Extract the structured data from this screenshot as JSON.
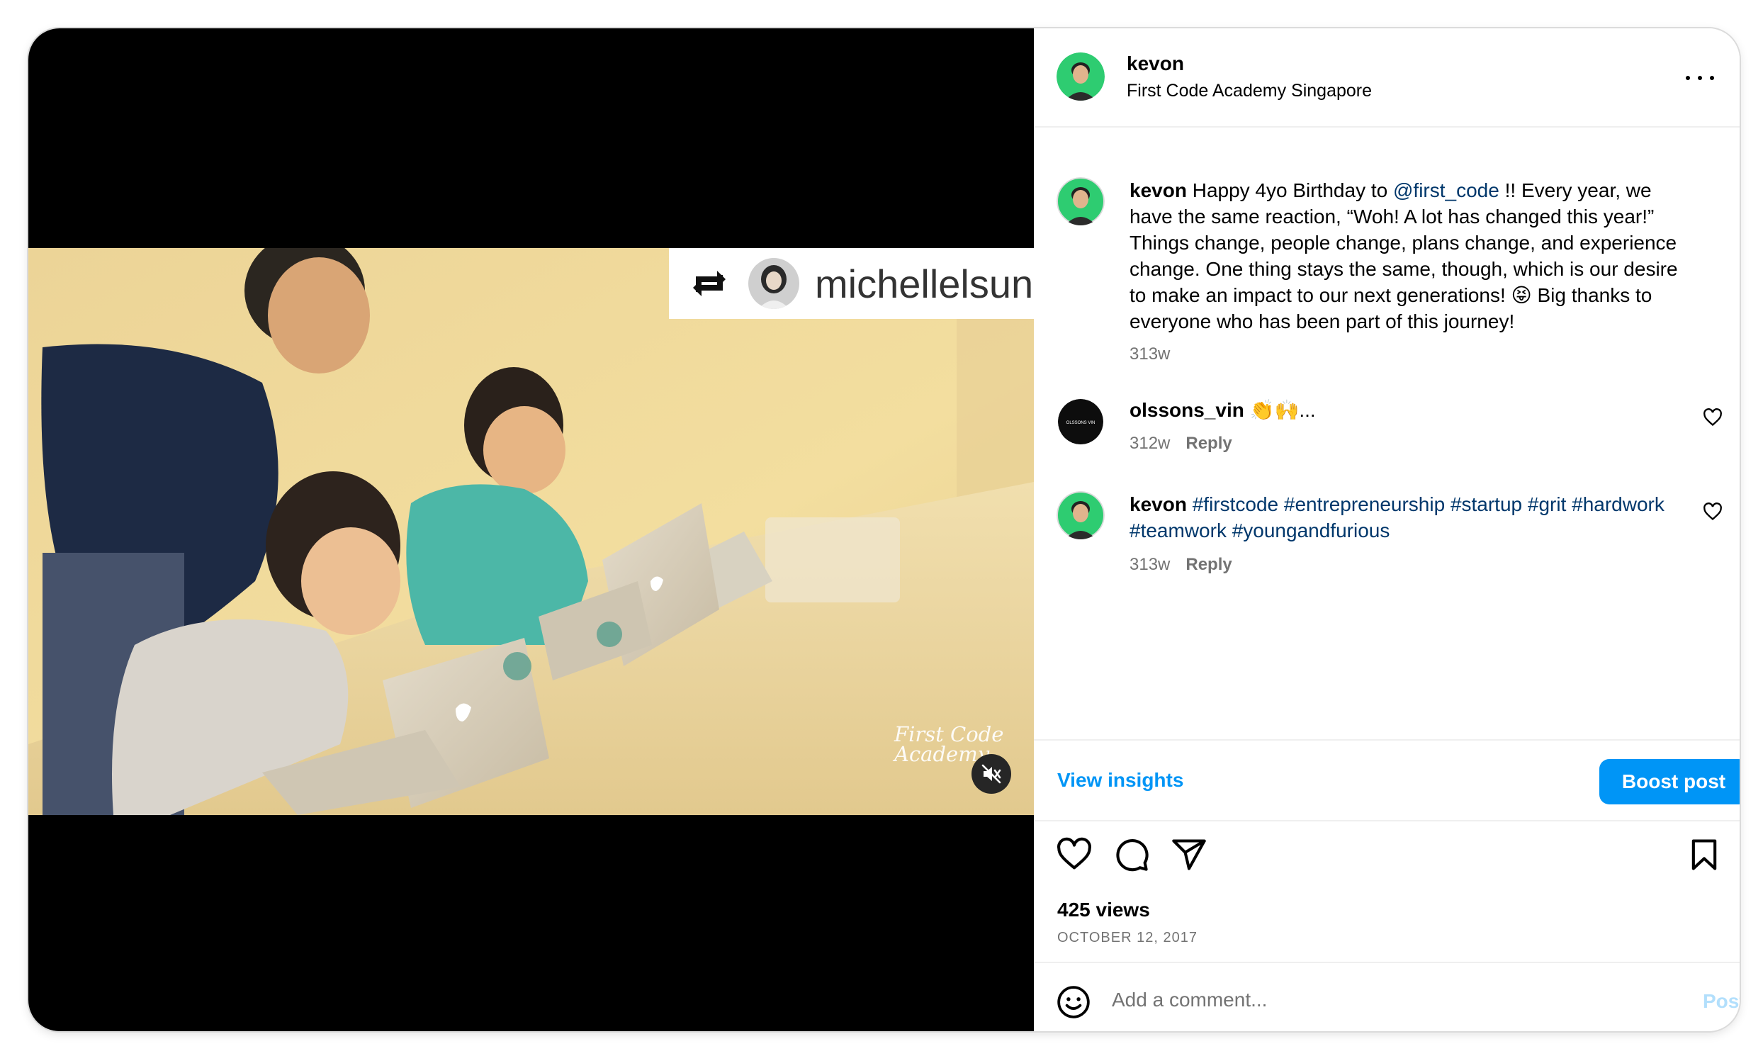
{
  "post": {
    "username": "kevon",
    "location": "First Code Academy Singapore"
  },
  "media": {
    "repost_username": "michellelsun",
    "watermark_line1": "First Code",
    "watermark_line2": "Academy",
    "muted": true
  },
  "caption": {
    "username": "kevon",
    "text_part1": "Happy 4yo Birthday to ",
    "mention": "@first_code",
    "text_part2": " !! Every year, we have the same reaction, “Woh! A lot has changed this year!” Things change, people change, plans change, and experience change. One thing stays the same, though, which is our desire to make an impact to our next generations! 😝 Big thanks to everyone who has been part of this journey!",
    "age": "313w"
  },
  "comments": [
    {
      "username": "olssons_vin",
      "text": "👏🙌...",
      "age": "312w",
      "reply_label": "Reply",
      "avatar_text": "OLSSONS VIN"
    },
    {
      "username": "kevon",
      "text": "#firstcode #entrepreneurship #startup #grit #hardwork #teamwork #youngandfurious",
      "age": "313w",
      "reply_label": "Reply"
    }
  ],
  "insights": {
    "view_label": "View insights",
    "boost_label": "Boost post"
  },
  "stats": {
    "views": "425 views",
    "date": "OCTOBER 12, 2017"
  },
  "comment_box": {
    "placeholder": "Add a comment...",
    "post_label": "Post"
  },
  "colors": {
    "accent": "#0095f6",
    "link": "#00376b",
    "secondary_text": "#737373",
    "avatar_bg": "#2ecc71",
    "post_disabled": "#b2dffc"
  },
  "icons": {
    "header_more": "more-horizontal-icon",
    "like": "heart-icon",
    "comment": "comment-bubble-icon",
    "share": "paper-plane-icon",
    "save": "bookmark-icon",
    "emoji": "smiley-icon",
    "mute": "speaker-muted-icon",
    "repost": "repost-icon"
  }
}
